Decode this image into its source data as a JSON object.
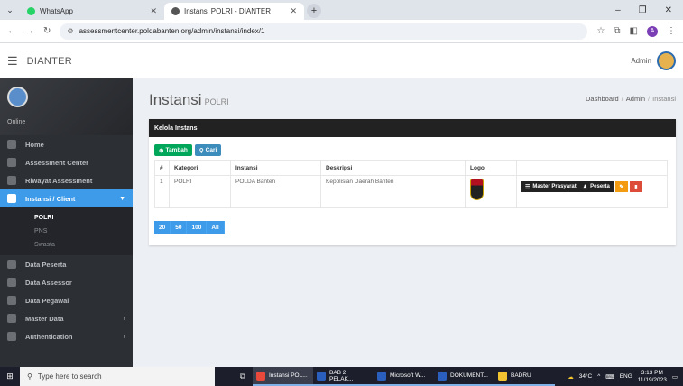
{
  "browser": {
    "tabs": [
      {
        "label": "WhatsApp",
        "active": false
      },
      {
        "label": "Instansi POLRI - DIANTER",
        "active": true
      }
    ],
    "url": "assessmentcenter.poldabanten.org/admin/instansi/index/1",
    "profile_initial": "A"
  },
  "app": {
    "brand": "DIANTER",
    "user_label": "Admin"
  },
  "sidebar": {
    "status": "Online",
    "items": [
      {
        "label": "Home"
      },
      {
        "label": "Assessment Center"
      },
      {
        "label": "Riwayat Assessment"
      },
      {
        "label": "Instansi / Client",
        "active": true
      },
      {
        "label": "Data Peserta"
      },
      {
        "label": "Data Assessor"
      },
      {
        "label": "Data Pegawai"
      },
      {
        "label": "Master Data"
      },
      {
        "label": "Authentication"
      }
    ],
    "submenu": [
      "POLRI",
      "PNS",
      "Swasta"
    ]
  },
  "page": {
    "title": "Instansi",
    "subtitle": "POLRI",
    "breadcrumb": [
      "Dashboard",
      "Admin",
      "Instansi"
    ]
  },
  "card": {
    "heading": "Kelola Instansi",
    "add_label": "Tambah",
    "search_label": "Cari",
    "columns": [
      "#",
      "Kategori",
      "Instansi",
      "Deskripsi",
      "Logo",
      ""
    ],
    "rows": [
      {
        "no": "1",
        "kategori": "POLRI",
        "instansi": "POLDA Banten",
        "deskripsi": "Kepolisian Daerah Banten"
      }
    ],
    "actions": {
      "master": "Master Prasyarat",
      "peserta": "Peserta"
    },
    "page_sizes": [
      "20",
      "50",
      "100",
      "All"
    ]
  },
  "taskbar": {
    "search_placeholder": "Type here to search",
    "apps": [
      {
        "label": "Instansi POL...",
        "color": "#e8493b"
      },
      {
        "label": "BAB 2 PELAK...",
        "color": "#2b5fbd"
      },
      {
        "label": "Microsoft W...",
        "color": "#2b5fbd"
      },
      {
        "label": "DOKUMENT...",
        "color": "#2b5fbd"
      },
      {
        "label": "BADRU",
        "color": "#f4c430"
      }
    ],
    "weather": "34°C",
    "lang": "ENG",
    "time": "3:13 PM",
    "date": "11/19/2023"
  }
}
